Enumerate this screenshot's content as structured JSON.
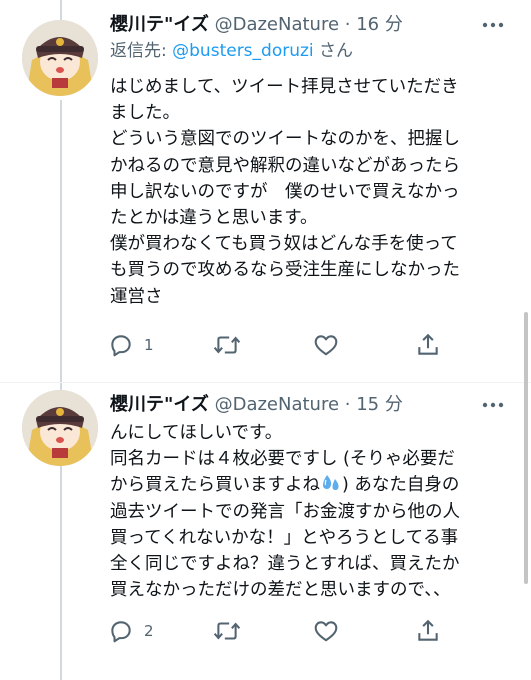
{
  "tweets": [
    {
      "display_name": "櫻川テ\"イズ",
      "handle": "@DazeNature",
      "separator": "·",
      "time": "16 分",
      "reply_prefix": "返信先: ",
      "reply_mention": "@busters_doruzi",
      "reply_suffix": " さん",
      "lines": [
        "はじめまして、ツイート拝見させていただき",
        "ました。",
        "どういう意図でのツイートなのかを、把握し",
        "かねるので意見や解釈の違いなどがあったら",
        "申し訳ないのですが　僕のせいで買えなかっ",
        "たとかは違うと思います。",
        "僕が買わなくても買う奴はどんな手を使って",
        "も買うので攻めるなら受注生産にしなかった",
        "運営さ"
      ],
      "reply_count": "1"
    },
    {
      "display_name": "櫻川テ\"イズ",
      "handle": "@DazeNature",
      "separator": "·",
      "time": "15 分",
      "lines": [
        "んにしてほしいです。",
        "同名カードは４枚必要ですし (そりゃ必要だ",
        "過去ツイートでの発言「お金渡すから他の人",
        "買ってくれないかな！」とやろうとしてる事",
        "全く同じですよね？違うとすれば、買えたか",
        "買えなかっただけの差だと思いますので、、"
      ],
      "line_with_emoji_before": "から買えたら買いますよね",
      "line_with_emoji_after": ") あなた自身の",
      "reply_count": "2"
    }
  ],
  "icons": {
    "more": "more-icon",
    "reply": "reply-icon",
    "retweet": "retweet-icon",
    "like": "like-icon",
    "share": "share-icon",
    "emoji": "sweat-droplets-emoji-icon"
  },
  "colors": {
    "link": "#1d9bf0",
    "secondary_text": "#536471",
    "primary_text": "#0f1419"
  }
}
